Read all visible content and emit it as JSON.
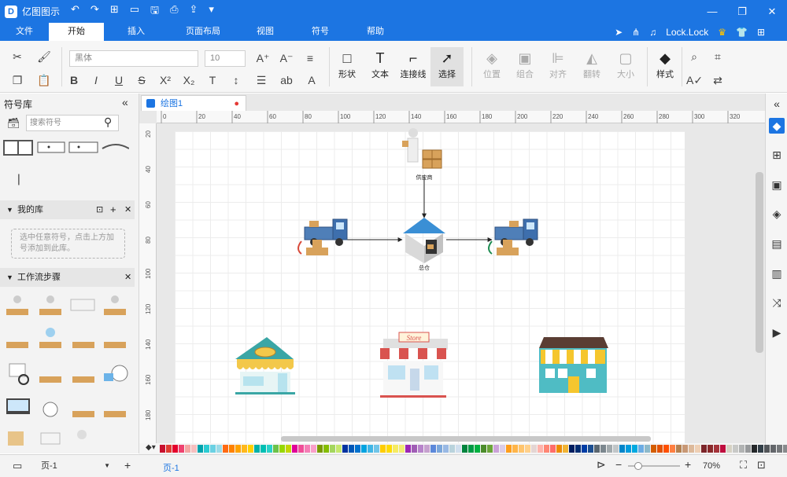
{
  "app": {
    "title": "亿图图示",
    "logo_glyph": "D"
  },
  "quick_access": [
    "↶",
    "↷",
    "⊞",
    "▭",
    "🖫",
    "⎙",
    "⇪",
    "▾"
  ],
  "window_controls": [
    "—",
    "❐",
    "✕"
  ],
  "menu": {
    "tabs": [
      "文件",
      "开始",
      "插入",
      "页面布局",
      "视图",
      "符号",
      "帮助"
    ],
    "active": "开始",
    "user": "Lock.Lock"
  },
  "ribbon": {
    "font": "黑体",
    "font_size": "10",
    "tools": {
      "shape": "形状",
      "text": "文本",
      "connector": "连接线",
      "select": "选择"
    },
    "arrange": {
      "position": "位置",
      "group": "组合",
      "align": "对齐",
      "flip": "翻转",
      "size": "大小"
    },
    "style": "样式"
  },
  "symbol_lib": {
    "title": "符号库",
    "search_placeholder": "搜索符号",
    "my_lib": "我的库",
    "my_lib_hint": "选中任意符号，点击上方加号添加到此库。",
    "workflow": "工作流步骤"
  },
  "document": {
    "tab": "绘图1"
  },
  "ruler": {
    "h": [
      "0",
      "20",
      "40",
      "60",
      "80",
      "100",
      "120",
      "140",
      "160",
      "180",
      "200",
      "220",
      "240",
      "260",
      "280",
      "300",
      "320"
    ],
    "v": [
      "20",
      "40",
      "60",
      "80",
      "100",
      "120",
      "140",
      "160",
      "180"
    ]
  },
  "diagram": {
    "supplier_label": "供应商",
    "warehouse_label": "总仓",
    "store_sign": "Store"
  },
  "palette_colors": [
    "#c8102e",
    "#e03c31",
    "#e4002b",
    "#ef426f",
    "#f4a6a3",
    "#f6bfbf",
    "#00a3ad",
    "#2dccd3",
    "#6ad1e3",
    "#9adbe8",
    "#ff6a13",
    "#ff8200",
    "#ffa300",
    "#ffb81c",
    "#ffd100",
    "#00b2a9",
    "#00bfb3",
    "#2ad2c9",
    "#6cc24a",
    "#97d700",
    "#c4d600",
    "#e10098",
    "#f04e98",
    "#f57eb6",
    "#f99fc9",
    "#7a9a01",
    "#84bd00",
    "#a4d65e",
    "#c5e86c",
    "#0033a0",
    "#0057b8",
    "#0072ce",
    "#00a3e0",
    "#41b6e6",
    "#71c5e8",
    "#ffcd00",
    "#fedb00",
    "#f6eb61",
    "#f0ec74",
    "#9b26b6",
    "#a05eb5",
    "#b884cb",
    "#c6a1cf",
    "#5c88da",
    "#7ba7db",
    "#99b9e4",
    "#b9d3dc",
    "#d0dfee",
    "#00843d",
    "#009a44",
    "#00b140",
    "#4c8c2b",
    "#6ba539",
    "#cba3d8",
    "#dbcde7",
    "#ff9e1b",
    "#ffb549",
    "#ffc56e",
    "#ffd08a",
    "#e4d5d3",
    "#ffb3ab",
    "#ff8674",
    "#ff6d6a",
    "#ed8b00",
    "#f1b434",
    "#001e60",
    "#002d72",
    "#003da5",
    "#1d4f91",
    "#5b6770",
    "#7c878e",
    "#a2aaad",
    "#c1c6c8",
    "#0085ca",
    "#009cde",
    "#00a9e0",
    "#6cace4",
    "#8db9ca",
    "#d45d00",
    "#e35205",
    "#fe5000",
    "#ff7f41",
    "#b58150",
    "#c89875",
    "#ddb99a",
    "#eecfb4",
    "#7c2529",
    "#8a2a2b",
    "#a4343a",
    "#bf0d3e",
    "#d6d2c4",
    "#c8c9c7",
    "#b1b3b3",
    "#97999b",
    "#25282a",
    "#333f48",
    "#53565a",
    "#63666a",
    "#75787b",
    "#888b8d",
    "#b7b9b9",
    "#d0d0ce",
    "#e7e7e7",
    "#ffffff"
  ],
  "status": {
    "page_select": "页-1",
    "page_tab": "页-1",
    "zoom": "70%",
    "zoom_value": 0.7
  }
}
